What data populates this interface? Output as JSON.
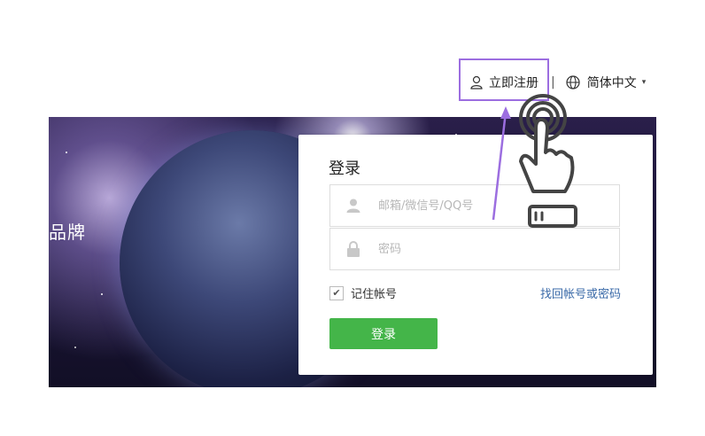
{
  "header": {
    "register_label": "立即注册",
    "separator": "|",
    "language_label": "简体中文",
    "caret": "▾"
  },
  "banner": {
    "brand_text": "品牌"
  },
  "login": {
    "title": "登录",
    "username_placeholder": "邮箱/微信号/QQ号",
    "password_placeholder": "密码",
    "remember_label": "记住帐号",
    "remember_checked": true,
    "forgot_label": "找回帐号或密码",
    "submit_label": "登录"
  },
  "colors": {
    "primary_button": "#44b549",
    "link": "#3a6aa8",
    "annotation": "#9c6ee0"
  }
}
